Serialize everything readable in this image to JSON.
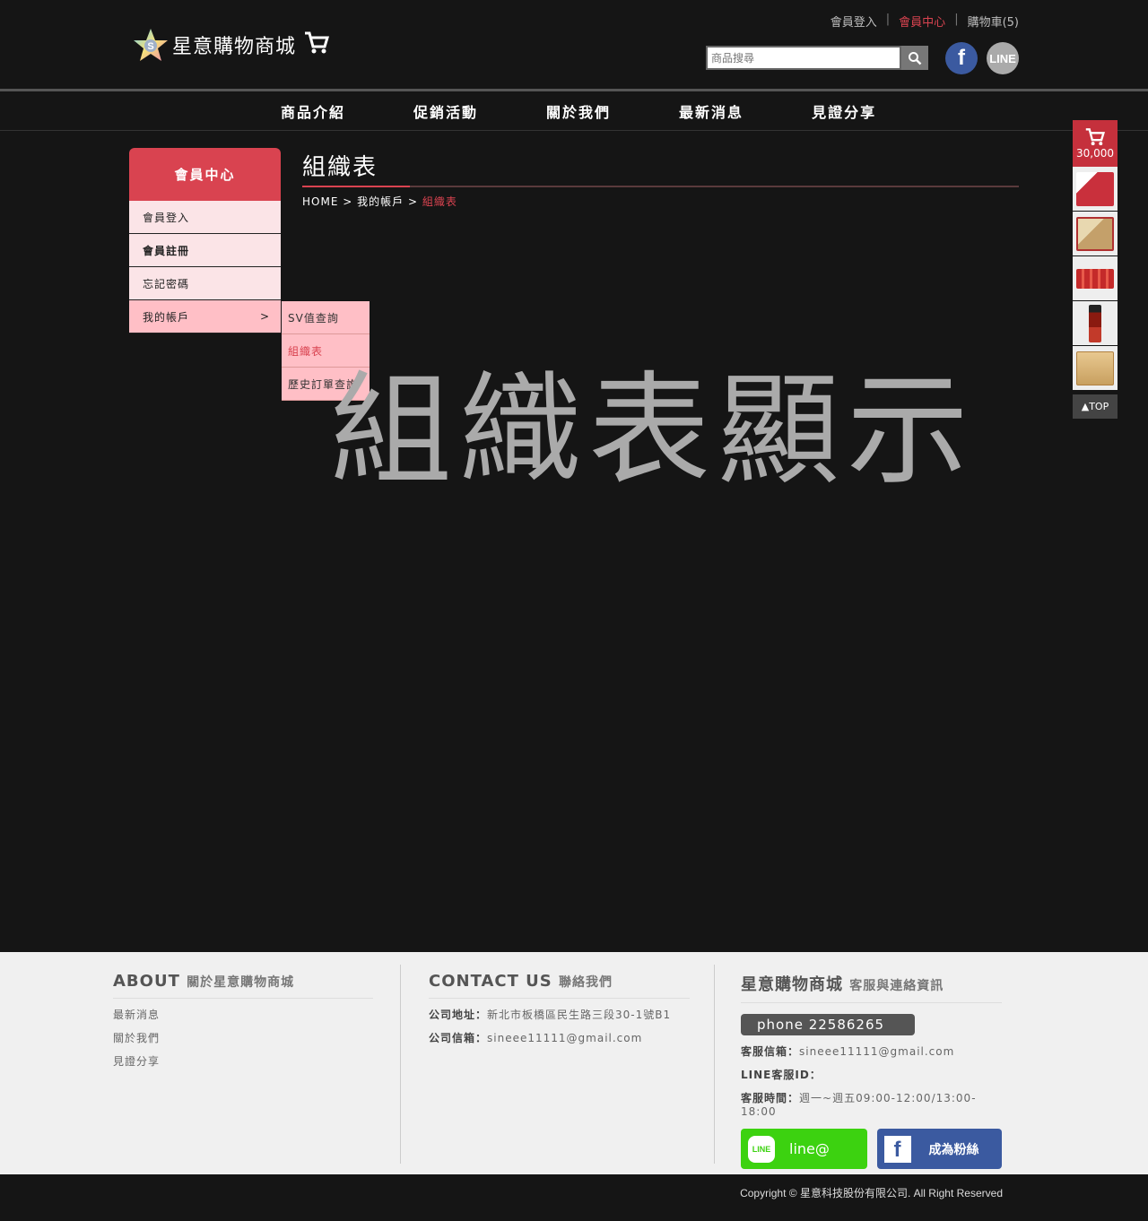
{
  "header": {
    "logo_text": "星意購物商城",
    "top_links": {
      "login": "會員登入",
      "member_center": "會員中心",
      "cart": "購物車(5)"
    },
    "search_placeholder": "商品搜尋",
    "facebook_label": "f",
    "line_label": "LINE"
  },
  "nav": {
    "items": [
      "商品介紹",
      "促銷活動",
      "關於我們",
      "最新消息",
      "見證分享"
    ]
  },
  "sidebar": {
    "title": "會員中心",
    "items": [
      {
        "label": "會員登入"
      },
      {
        "label": "會員註冊"
      },
      {
        "label": "忘記密碼"
      },
      {
        "label": "我的帳戶",
        "arrow": ">"
      }
    ],
    "submenu": [
      "SV值查詢",
      "組織表",
      "歷史訂單查詢"
    ]
  },
  "main": {
    "title": "組織表",
    "breadcrumb": {
      "home": "HOME",
      "sep": ">",
      "account": "我的帳戶",
      "current": "組織表"
    },
    "placeholder_text": "組織表顯示"
  },
  "float_panel": {
    "cart_total": "30,000",
    "top_label": "▲TOP",
    "products": [
      "#c9303c",
      "#c4a06a",
      "#c42a2a",
      "#8a1a10",
      "#c8a060"
    ]
  },
  "footer": {
    "about": {
      "title": "ABOUT",
      "subtitle": "關於星意購物商城",
      "links": [
        "最新消息",
        "關於我們",
        "見證分享"
      ]
    },
    "contact": {
      "title": "CONTACT US",
      "subtitle": "聯絡我們",
      "address_label": "公司地址：",
      "address": "新北市板橋區民生路三段30-1號B1",
      "email_label": "公司信箱：",
      "email": "sineee11111@gmail.com"
    },
    "service": {
      "title": "星意購物商城",
      "subtitle": "客服與連絡資訊",
      "phone": "phone 22586265",
      "email_label": "客服信箱：",
      "email": "sineee11111@gmail.com",
      "line_label": "LINE客服ID：",
      "line_id": "",
      "hours_label": "客服時間：",
      "hours": "週一~週五09:00-12:00/13:00-18:00",
      "line_button": "line@",
      "line_icon_text": "LINE",
      "fb_button": "成為粉絲",
      "fb_icon_text": "f"
    },
    "copyright": "Copyright © 星意科技股份有限公司. All Right Reserved"
  },
  "colors": {
    "accent": "#d94350",
    "sidebar_bg": "#fbe4e7",
    "submenu_bg": "#ffbfc6",
    "line_green": "#3cd210",
    "fb_blue": "#3b5aa0"
  }
}
